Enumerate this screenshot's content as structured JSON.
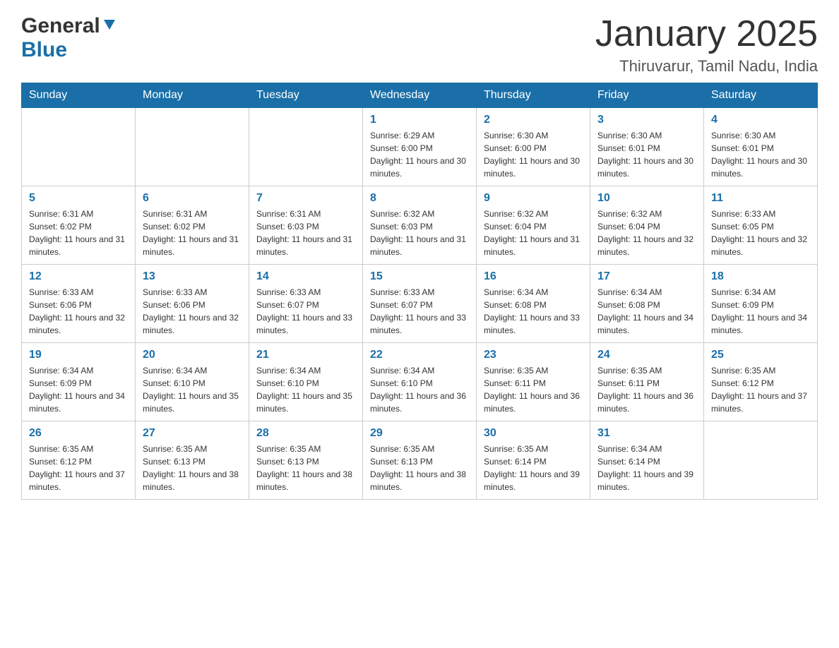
{
  "header": {
    "logo_general": "General",
    "logo_blue": "Blue",
    "title": "January 2025",
    "subtitle": "Thiruvarur, Tamil Nadu, India"
  },
  "days_of_week": [
    "Sunday",
    "Monday",
    "Tuesday",
    "Wednesday",
    "Thursday",
    "Friday",
    "Saturday"
  ],
  "weeks": [
    [
      {
        "day": "",
        "info": ""
      },
      {
        "day": "",
        "info": ""
      },
      {
        "day": "",
        "info": ""
      },
      {
        "day": "1",
        "info": "Sunrise: 6:29 AM\nSunset: 6:00 PM\nDaylight: 11 hours and 30 minutes."
      },
      {
        "day": "2",
        "info": "Sunrise: 6:30 AM\nSunset: 6:00 PM\nDaylight: 11 hours and 30 minutes."
      },
      {
        "day": "3",
        "info": "Sunrise: 6:30 AM\nSunset: 6:01 PM\nDaylight: 11 hours and 30 minutes."
      },
      {
        "day": "4",
        "info": "Sunrise: 6:30 AM\nSunset: 6:01 PM\nDaylight: 11 hours and 30 minutes."
      }
    ],
    [
      {
        "day": "5",
        "info": "Sunrise: 6:31 AM\nSunset: 6:02 PM\nDaylight: 11 hours and 31 minutes."
      },
      {
        "day": "6",
        "info": "Sunrise: 6:31 AM\nSunset: 6:02 PM\nDaylight: 11 hours and 31 minutes."
      },
      {
        "day": "7",
        "info": "Sunrise: 6:31 AM\nSunset: 6:03 PM\nDaylight: 11 hours and 31 minutes."
      },
      {
        "day": "8",
        "info": "Sunrise: 6:32 AM\nSunset: 6:03 PM\nDaylight: 11 hours and 31 minutes."
      },
      {
        "day": "9",
        "info": "Sunrise: 6:32 AM\nSunset: 6:04 PM\nDaylight: 11 hours and 31 minutes."
      },
      {
        "day": "10",
        "info": "Sunrise: 6:32 AM\nSunset: 6:04 PM\nDaylight: 11 hours and 32 minutes."
      },
      {
        "day": "11",
        "info": "Sunrise: 6:33 AM\nSunset: 6:05 PM\nDaylight: 11 hours and 32 minutes."
      }
    ],
    [
      {
        "day": "12",
        "info": "Sunrise: 6:33 AM\nSunset: 6:06 PM\nDaylight: 11 hours and 32 minutes."
      },
      {
        "day": "13",
        "info": "Sunrise: 6:33 AM\nSunset: 6:06 PM\nDaylight: 11 hours and 32 minutes."
      },
      {
        "day": "14",
        "info": "Sunrise: 6:33 AM\nSunset: 6:07 PM\nDaylight: 11 hours and 33 minutes."
      },
      {
        "day": "15",
        "info": "Sunrise: 6:33 AM\nSunset: 6:07 PM\nDaylight: 11 hours and 33 minutes."
      },
      {
        "day": "16",
        "info": "Sunrise: 6:34 AM\nSunset: 6:08 PM\nDaylight: 11 hours and 33 minutes."
      },
      {
        "day": "17",
        "info": "Sunrise: 6:34 AM\nSunset: 6:08 PM\nDaylight: 11 hours and 34 minutes."
      },
      {
        "day": "18",
        "info": "Sunrise: 6:34 AM\nSunset: 6:09 PM\nDaylight: 11 hours and 34 minutes."
      }
    ],
    [
      {
        "day": "19",
        "info": "Sunrise: 6:34 AM\nSunset: 6:09 PM\nDaylight: 11 hours and 34 minutes."
      },
      {
        "day": "20",
        "info": "Sunrise: 6:34 AM\nSunset: 6:10 PM\nDaylight: 11 hours and 35 minutes."
      },
      {
        "day": "21",
        "info": "Sunrise: 6:34 AM\nSunset: 6:10 PM\nDaylight: 11 hours and 35 minutes."
      },
      {
        "day": "22",
        "info": "Sunrise: 6:34 AM\nSunset: 6:10 PM\nDaylight: 11 hours and 36 minutes."
      },
      {
        "day": "23",
        "info": "Sunrise: 6:35 AM\nSunset: 6:11 PM\nDaylight: 11 hours and 36 minutes."
      },
      {
        "day": "24",
        "info": "Sunrise: 6:35 AM\nSunset: 6:11 PM\nDaylight: 11 hours and 36 minutes."
      },
      {
        "day": "25",
        "info": "Sunrise: 6:35 AM\nSunset: 6:12 PM\nDaylight: 11 hours and 37 minutes."
      }
    ],
    [
      {
        "day": "26",
        "info": "Sunrise: 6:35 AM\nSunset: 6:12 PM\nDaylight: 11 hours and 37 minutes."
      },
      {
        "day": "27",
        "info": "Sunrise: 6:35 AM\nSunset: 6:13 PM\nDaylight: 11 hours and 38 minutes."
      },
      {
        "day": "28",
        "info": "Sunrise: 6:35 AM\nSunset: 6:13 PM\nDaylight: 11 hours and 38 minutes."
      },
      {
        "day": "29",
        "info": "Sunrise: 6:35 AM\nSunset: 6:13 PM\nDaylight: 11 hours and 38 minutes."
      },
      {
        "day": "30",
        "info": "Sunrise: 6:35 AM\nSunset: 6:14 PM\nDaylight: 11 hours and 39 minutes."
      },
      {
        "day": "31",
        "info": "Sunrise: 6:34 AM\nSunset: 6:14 PM\nDaylight: 11 hours and 39 minutes."
      },
      {
        "day": "",
        "info": ""
      }
    ]
  ]
}
